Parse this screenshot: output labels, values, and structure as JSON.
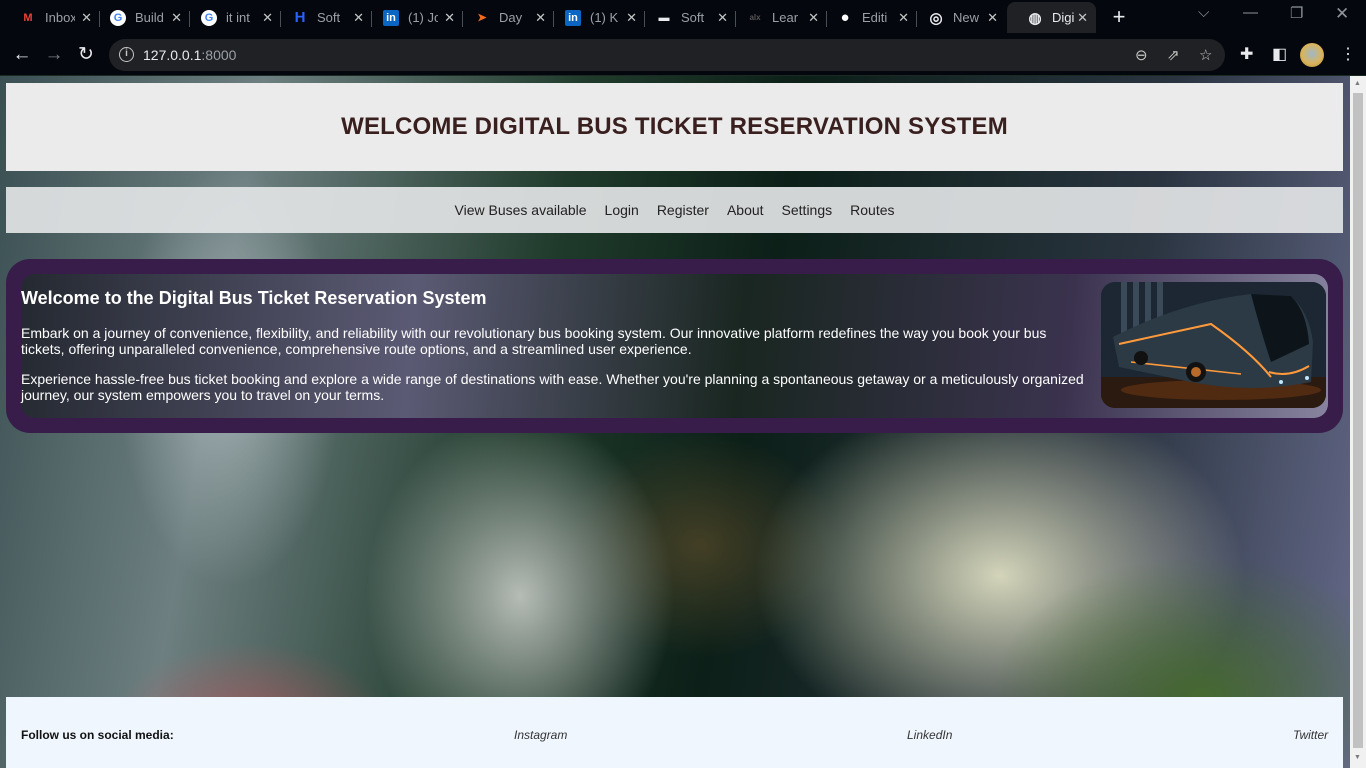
{
  "browser": {
    "tabs": [
      {
        "title": "Inbox",
        "icon": "gmail-icon",
        "glyph": "M",
        "color": "#ea4335",
        "bg": "transparent"
      },
      {
        "title": "Build",
        "icon": "google-icon",
        "glyph": "G",
        "color": "#4285f4",
        "bg": "#ffffff"
      },
      {
        "title": "it int",
        "icon": "google-icon",
        "glyph": "G",
        "color": "#4285f4",
        "bg": "#ffffff"
      },
      {
        "title": "Soft",
        "icon": "hashnode-icon",
        "glyph": "H",
        "color": "#2962ff",
        "bg": "transparent"
      },
      {
        "title": "(1) Jo",
        "icon": "linkedin-icon",
        "glyph": "in",
        "color": "#ffffff",
        "bg": "#0a66c2"
      },
      {
        "title": "Day",
        "icon": "dayjs-icon",
        "glyph": "➤",
        "color": "#f26b1d",
        "bg": "transparent"
      },
      {
        "title": "(1) K",
        "icon": "linkedin-icon",
        "glyph": "in",
        "color": "#ffffff",
        "bg": "#0a66c2"
      },
      {
        "title": "Soft",
        "icon": "laptop-icon",
        "glyph": "▬",
        "color": "#e8eaed",
        "bg": "transparent"
      },
      {
        "title": "Lear",
        "icon": "alx-icon",
        "glyph": "alx",
        "color": "#555555",
        "bg": "transparent"
      },
      {
        "title": "Editi",
        "icon": "github-icon",
        "glyph": "●",
        "color": "#ffffff",
        "bg": "transparent"
      },
      {
        "title": "New",
        "icon": "chrome-icon",
        "glyph": "◎",
        "color": "#e8eaed",
        "bg": "transparent"
      },
      {
        "title": "Digi",
        "icon": "globe-icon",
        "glyph": "◍",
        "color": "#e8eaed",
        "bg": "transparent",
        "active": true
      }
    ],
    "new_tab_label": "+",
    "url_host": "127.0.0.1",
    "url_port": ":8000"
  },
  "page": {
    "header_title": "WELCOME DIGITAL BUS TICKET RESERVATION SYSTEM",
    "nav": [
      "View Buses available",
      "Login",
      "Register",
      "About",
      "Settings",
      "Routes"
    ],
    "welcome": {
      "heading": "Welcome to the Digital Bus Ticket Reservation System",
      "paragraphs": [
        "Embark on a journey of convenience, flexibility, and reliability with our revolutionary bus booking system. Our innovative platform redefines the way you book your bus tickets, offering unparalleled convenience, comprehensive route options, and a streamlined user experience.",
        "Experience hassle-free bus ticket booking and explore a wide range of destinations with ease. Whether you're planning a spontaneous getaway or a meticulously organized journey, our system empowers you to travel on your terms."
      ]
    },
    "footer": {
      "follow_label": "Follow us on social media:",
      "links": [
        "Instagram",
        "LinkedIn",
        "Twitter"
      ]
    }
  }
}
